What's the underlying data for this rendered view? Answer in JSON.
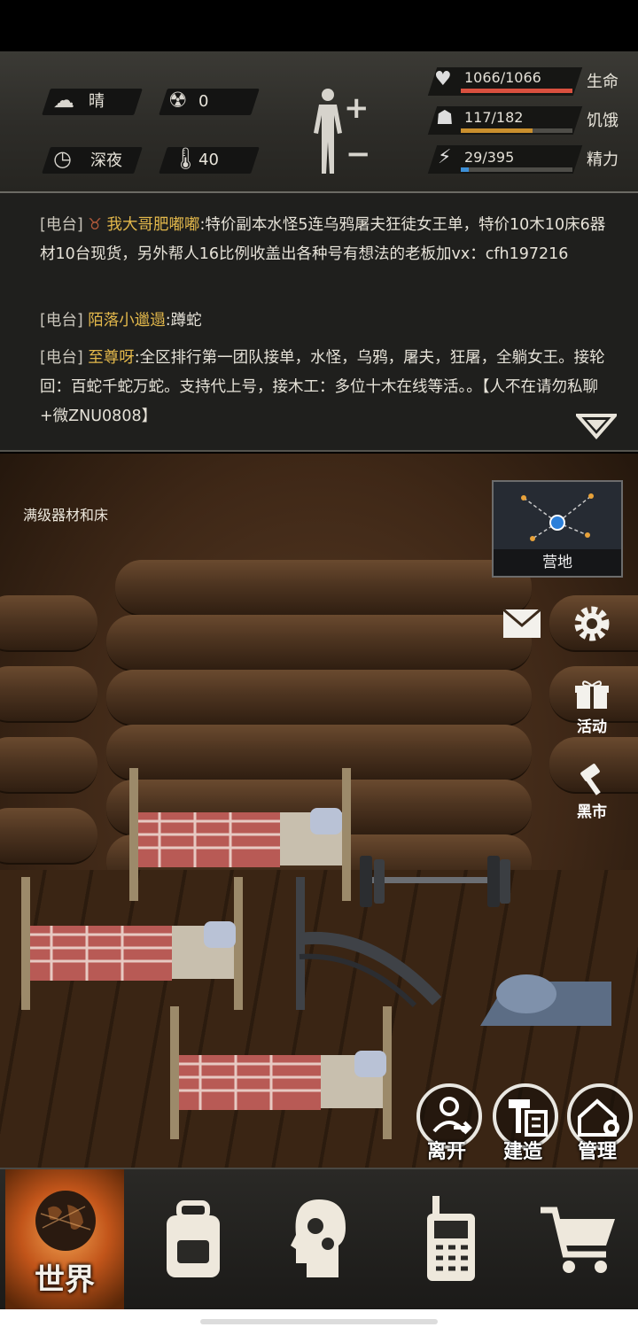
{
  "stats": {
    "weather": "晴",
    "radiation": "0",
    "time_of_day": "深夜",
    "temperature": "40",
    "health": {
      "value": "1066/1066",
      "label": "生命",
      "ratio": 1.0,
      "color": "#d9503f"
    },
    "hunger": {
      "value": "117/182",
      "label": "饥饿",
      "ratio": 0.643,
      "color": "#c98f2e"
    },
    "energy": {
      "value": "29/395",
      "label": "精力",
      "ratio": 0.073,
      "color": "#3d8fd6"
    }
  },
  "chat": {
    "messages": [
      {
        "channel": "[电台]",
        "name": "我大哥肥嘟嘟",
        "text": ":特价副本水怪5连乌鸦屠夫狂徒女王单，特价10木10床6器材10台现货，另外帮人16比例收盖出各种号有想法的老板加vx：cfh197216"
      },
      {
        "channel": "[电台]",
        "name": "陌落小邋遢",
        "text": ":蹲蛇"
      },
      {
        "channel": "[电台]",
        "name": "至尊呀",
        "text": ":全区排行第一团队接单，水怪，乌鸦，屠夫，狂屠，全躺女王。接轮回：百蛇千蛇万蛇。支持代上号，接木工：多位十木在线等活。。【人不在请勿私聊+微ZNU0808】"
      }
    ]
  },
  "scene": {
    "label": "满级器材和床",
    "minimap_label": "营地",
    "side": {
      "activity": "活动",
      "black_market": "黑市"
    },
    "actions": {
      "leave": "离开",
      "build": "建造",
      "manage": "管理"
    }
  },
  "nav": {
    "world": "世界"
  }
}
